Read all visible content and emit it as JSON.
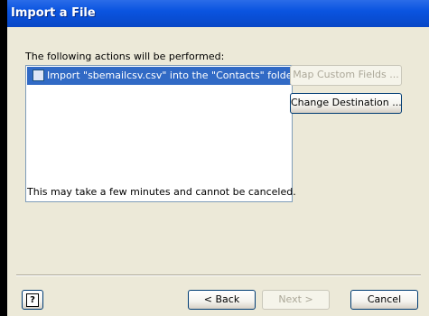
{
  "window": {
    "title": "Import a File"
  },
  "dialog": {
    "heading": "The following actions will be performed:",
    "actions": [
      {
        "label": "Import \"sbemailcsv.csv\" into the \"Contacts\" folder",
        "checked": false,
        "selected": true
      }
    ],
    "map_fields_label": "Map Custom Fields ...",
    "change_destination_label": "Change Destination ...",
    "note": "This may take a few minutes and cannot be canceled."
  },
  "footer": {
    "help_glyph": "?",
    "back_label": "< Back",
    "next_label": "Next >",
    "cancel_label": "Cancel"
  },
  "colors": {
    "titlebar": "#0A54E0",
    "selection": "#316AC5",
    "dialog_bg": "#ECE9D8"
  }
}
